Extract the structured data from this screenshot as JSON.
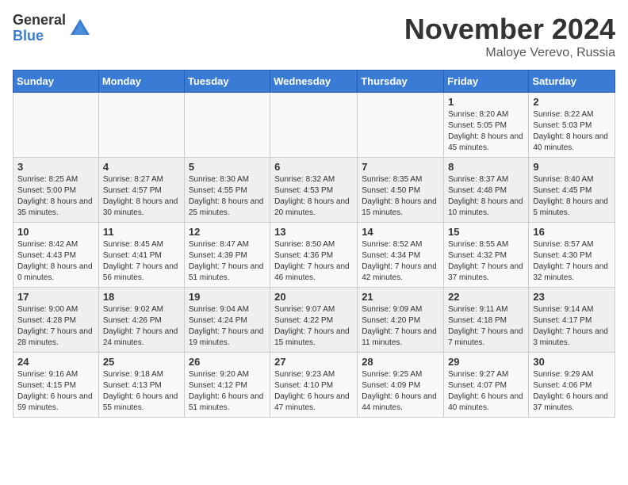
{
  "logo": {
    "general": "General",
    "blue": "Blue"
  },
  "title": "November 2024",
  "location": "Maloye Verevo, Russia",
  "days_of_week": [
    "Sunday",
    "Monday",
    "Tuesday",
    "Wednesday",
    "Thursday",
    "Friday",
    "Saturday"
  ],
  "weeks": [
    [
      {
        "day": "",
        "info": ""
      },
      {
        "day": "",
        "info": ""
      },
      {
        "day": "",
        "info": ""
      },
      {
        "day": "",
        "info": ""
      },
      {
        "day": "",
        "info": ""
      },
      {
        "day": "1",
        "info": "Sunrise: 8:20 AM\nSunset: 5:05 PM\nDaylight: 8 hours and 45 minutes."
      },
      {
        "day": "2",
        "info": "Sunrise: 8:22 AM\nSunset: 5:03 PM\nDaylight: 8 hours and 40 minutes."
      }
    ],
    [
      {
        "day": "3",
        "info": "Sunrise: 8:25 AM\nSunset: 5:00 PM\nDaylight: 8 hours and 35 minutes."
      },
      {
        "day": "4",
        "info": "Sunrise: 8:27 AM\nSunset: 4:57 PM\nDaylight: 8 hours and 30 minutes."
      },
      {
        "day": "5",
        "info": "Sunrise: 8:30 AM\nSunset: 4:55 PM\nDaylight: 8 hours and 25 minutes."
      },
      {
        "day": "6",
        "info": "Sunrise: 8:32 AM\nSunset: 4:53 PM\nDaylight: 8 hours and 20 minutes."
      },
      {
        "day": "7",
        "info": "Sunrise: 8:35 AM\nSunset: 4:50 PM\nDaylight: 8 hours and 15 minutes."
      },
      {
        "day": "8",
        "info": "Sunrise: 8:37 AM\nSunset: 4:48 PM\nDaylight: 8 hours and 10 minutes."
      },
      {
        "day": "9",
        "info": "Sunrise: 8:40 AM\nSunset: 4:45 PM\nDaylight: 8 hours and 5 minutes."
      }
    ],
    [
      {
        "day": "10",
        "info": "Sunrise: 8:42 AM\nSunset: 4:43 PM\nDaylight: 8 hours and 0 minutes."
      },
      {
        "day": "11",
        "info": "Sunrise: 8:45 AM\nSunset: 4:41 PM\nDaylight: 7 hours and 56 minutes."
      },
      {
        "day": "12",
        "info": "Sunrise: 8:47 AM\nSunset: 4:39 PM\nDaylight: 7 hours and 51 minutes."
      },
      {
        "day": "13",
        "info": "Sunrise: 8:50 AM\nSunset: 4:36 PM\nDaylight: 7 hours and 46 minutes."
      },
      {
        "day": "14",
        "info": "Sunrise: 8:52 AM\nSunset: 4:34 PM\nDaylight: 7 hours and 42 minutes."
      },
      {
        "day": "15",
        "info": "Sunrise: 8:55 AM\nSunset: 4:32 PM\nDaylight: 7 hours and 37 minutes."
      },
      {
        "day": "16",
        "info": "Sunrise: 8:57 AM\nSunset: 4:30 PM\nDaylight: 7 hours and 32 minutes."
      }
    ],
    [
      {
        "day": "17",
        "info": "Sunrise: 9:00 AM\nSunset: 4:28 PM\nDaylight: 7 hours and 28 minutes."
      },
      {
        "day": "18",
        "info": "Sunrise: 9:02 AM\nSunset: 4:26 PM\nDaylight: 7 hours and 24 minutes."
      },
      {
        "day": "19",
        "info": "Sunrise: 9:04 AM\nSunset: 4:24 PM\nDaylight: 7 hours and 19 minutes."
      },
      {
        "day": "20",
        "info": "Sunrise: 9:07 AM\nSunset: 4:22 PM\nDaylight: 7 hours and 15 minutes."
      },
      {
        "day": "21",
        "info": "Sunrise: 9:09 AM\nSunset: 4:20 PM\nDaylight: 7 hours and 11 minutes."
      },
      {
        "day": "22",
        "info": "Sunrise: 9:11 AM\nSunset: 4:18 PM\nDaylight: 7 hours and 7 minutes."
      },
      {
        "day": "23",
        "info": "Sunrise: 9:14 AM\nSunset: 4:17 PM\nDaylight: 7 hours and 3 minutes."
      }
    ],
    [
      {
        "day": "24",
        "info": "Sunrise: 9:16 AM\nSunset: 4:15 PM\nDaylight: 6 hours and 59 minutes."
      },
      {
        "day": "25",
        "info": "Sunrise: 9:18 AM\nSunset: 4:13 PM\nDaylight: 6 hours and 55 minutes."
      },
      {
        "day": "26",
        "info": "Sunrise: 9:20 AM\nSunset: 4:12 PM\nDaylight: 6 hours and 51 minutes."
      },
      {
        "day": "27",
        "info": "Sunrise: 9:23 AM\nSunset: 4:10 PM\nDaylight: 6 hours and 47 minutes."
      },
      {
        "day": "28",
        "info": "Sunrise: 9:25 AM\nSunset: 4:09 PM\nDaylight: 6 hours and 44 minutes."
      },
      {
        "day": "29",
        "info": "Sunrise: 9:27 AM\nSunset: 4:07 PM\nDaylight: 6 hours and 40 minutes."
      },
      {
        "day": "30",
        "info": "Sunrise: 9:29 AM\nSunset: 4:06 PM\nDaylight: 6 hours and 37 minutes."
      }
    ]
  ]
}
